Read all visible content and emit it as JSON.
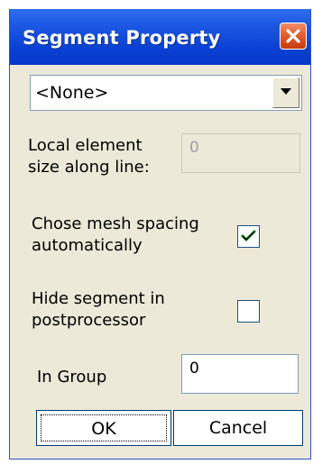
{
  "window": {
    "title": "Segment Property"
  },
  "segment_combo": {
    "value": "<None>"
  },
  "local_element_size": {
    "label_line1": "Local element",
    "label_line2": "size along line:",
    "value": "0"
  },
  "auto_spacing": {
    "label_line1": "Chose mesh spacing",
    "label_line2": "automatically",
    "checked": true
  },
  "hide_segment": {
    "label_line1": "Hide segment in",
    "label_line2": "postprocessor",
    "checked": false
  },
  "in_group": {
    "label": "In Group",
    "value": "0"
  },
  "buttons": {
    "ok_label": "OK",
    "cancel_label": "Cancel"
  },
  "icons": {
    "close": "close-icon",
    "dropdown": "chevron-down-icon",
    "check": "checkmark-icon"
  },
  "colors": {
    "titlebar": "#0a41d3",
    "close_button": "#e35a2c",
    "dialog_background": "#ece9d8"
  }
}
